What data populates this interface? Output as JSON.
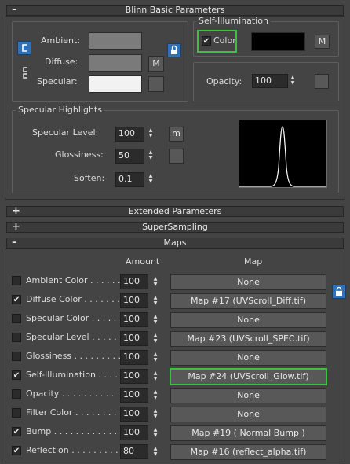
{
  "rollouts": {
    "basic": {
      "sign": "–",
      "title": "Blinn Basic Parameters"
    },
    "extended": {
      "sign": "+",
      "title": "Extended Parameters"
    },
    "supersampling": {
      "sign": "+",
      "title": "SuperSampling"
    },
    "maps": {
      "sign": "–",
      "title": "Maps"
    }
  },
  "basic": {
    "ambient_label": "Ambient:",
    "diffuse_label": "Diffuse:",
    "specular_label": "Specular:",
    "m_label": "M",
    "ambient_color": "#7c7c7c",
    "diffuse_color": "#7a7a7a",
    "specular_color": "#f2f2f2",
    "lock_icon": "lock-icon"
  },
  "self_illum": {
    "group_title": "Self-Illumination",
    "color_label": "Color",
    "checked": true,
    "check_mark": "✔",
    "swatch_color": "#000000",
    "m_label": "M"
  },
  "opacity": {
    "label": "Opacity:",
    "value": "100"
  },
  "specular": {
    "group_title": "Specular Highlights",
    "level_label": "Specular Level:",
    "level_value": "100",
    "level_m": "m",
    "gloss_label": "Glossiness:",
    "gloss_value": "50",
    "soften_label": "Soften:",
    "soften_value": "0.1"
  },
  "maps": {
    "amount_header": "Amount",
    "map_header": "Map",
    "rows": [
      {
        "label": "Ambient Color . . . . . . .",
        "checked": false,
        "amount": "100",
        "map": "None"
      },
      {
        "label": "Diffuse Color . . . . . . . .",
        "checked": true,
        "amount": "100",
        "map": "Map #17 (UVScroll_Diff.tif)"
      },
      {
        "label": "Specular Color . . . . . .",
        "checked": false,
        "amount": "100",
        "map": "None"
      },
      {
        "label": "Specular Level . . . . . .",
        "checked": false,
        "amount": "100",
        "map": "Map #23 (UVScroll_SPEC.tif)"
      },
      {
        "label": "Glossiness . . . . . . . . .",
        "checked": false,
        "amount": "100",
        "map": "None"
      },
      {
        "label": "Self-Illumination . . . . .",
        "checked": true,
        "amount": "100",
        "map": "Map #24 (UVScroll_Glow.tif)"
      },
      {
        "label": "Opacity . . . . . . . . . . .",
        "checked": false,
        "amount": "100",
        "map": "None"
      },
      {
        "label": "Filter Color . . . . . . . .",
        "checked": false,
        "amount": "100",
        "map": "None"
      },
      {
        "label": "Bump . . . . . . . . . . . .",
        "checked": true,
        "amount": "100",
        "map": "Map #19  ( Normal Bump )"
      },
      {
        "label": "Reflection . . . . . . . . .",
        "checked": true,
        "amount": "80",
        "map": "Map #16 (reflect_alpha.tif)"
      }
    ]
  },
  "colors": {
    "highlight_green": "#3ec23e",
    "accent_blue": "#2f72b8"
  }
}
